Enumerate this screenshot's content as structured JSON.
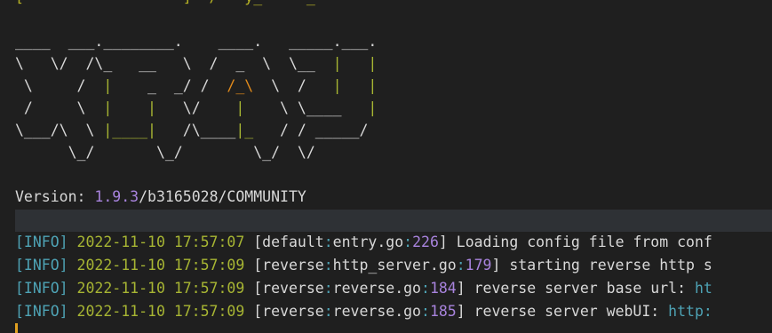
{
  "partial_top_line": "[                  ]  /   y_     _",
  "banner": {
    "row1": "____  ___.________.    ____.   _____.___.",
    "row2a": "\\   \\/  /\\_   __   \\  /  _  \\  \\__  ",
    "row2b": "|   |",
    "row3a": " \\     /  ",
    "row3b": "|",
    "row3c": "    _  _/ /  ",
    "row3d": "/_\\",
    "row3e": "  \\  /   ",
    "row3f": "|   |",
    "row4a": " /     \\  ",
    "row4b": "|",
    "row4c": "    ",
    "row4d": "|",
    "row4e": "   \\/    ",
    "row4f": "|",
    "row4g": "    \\ \\____   ",
    "row4h": "|",
    "row5a": "\\___/\\  \\ ",
    "row5b": "|____|",
    "row5c": "   /\\____",
    "row5d": "|_",
    "row5e": "   / / _____/",
    "row6": "      \\_/       \\_/        \\_/  \\/"
  },
  "version": {
    "label": "Version",
    "sep": ": ",
    "number": "1.9.3",
    "rest": "/b3165028/COMMUNITY"
  },
  "logs": [
    {
      "level": "[INFO]",
      "timestamp": "2022-11-10 17:57:07",
      "module": "default",
      "file": "entry.go",
      "line": "226",
      "message": " Loading config file from conf",
      "tail": ""
    },
    {
      "level": "[INFO]",
      "timestamp": "2022-11-10 17:57:09",
      "module": "reverse",
      "file": "http_server.go",
      "line": "179",
      "message": " starting reverse http s",
      "tail": ""
    },
    {
      "level": "[INFO]",
      "timestamp": "2022-11-10 17:57:09",
      "module": "reverse",
      "file": "reverse.go",
      "line": "184",
      "message": " reverse server base url: ",
      "tail": "ht"
    },
    {
      "level": "[INFO]",
      "timestamp": "2022-11-10 17:57:09",
      "module": "reverse",
      "file": "reverse.go",
      "line": "185",
      "message": " reverse server webUI: ",
      "tail": "http:"
    }
  ],
  "colors": {
    "background": "#1f1f1f",
    "text": "#d8d8d8",
    "level": "#4ea3b5",
    "timestamp": "#a7b533",
    "number": "#a883dd",
    "logo_accent": "#b7b325",
    "logo_highlight": "#e08a1b",
    "cursor": "#e0a020"
  }
}
